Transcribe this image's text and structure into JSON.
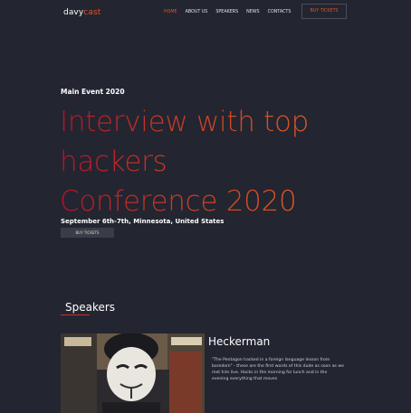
{
  "nav": {
    "logo_part1": "davy",
    "logo_part2": "cast",
    "items": [
      {
        "label": "HOME",
        "active": true
      },
      {
        "label": "ABOUT US",
        "active": false
      },
      {
        "label": "SPEAKERS",
        "active": false
      },
      {
        "label": "NEWS",
        "active": false
      },
      {
        "label": "CONTACTS",
        "active": false
      }
    ],
    "buy_tickets": "BUY TICKETS"
  },
  "hero": {
    "eyebrow": "Main Event 2020",
    "headline_line1": "Interview with top",
    "headline_line2": "hackers",
    "headline_line3": "Conference 2020",
    "date_location": "September 6th-7th, Minnesota, United States",
    "button": "BUY TICKETS"
  },
  "speakers": {
    "section_title": "Speakers",
    "items": [
      {
        "name": "Heckerman",
        "bio": "\"The Pentagon hacked in a foreign language lesson from boredom\" - these are the first words of this dude as soon as we met him live. Hacks in the morning for lunch and in the evening everything that moves"
      }
    ]
  },
  "colors": {
    "background": "#232531",
    "accent": "#e0532a",
    "headline_gradient_start": "#b2142c",
    "headline_gradient_end": "#e05f28"
  }
}
